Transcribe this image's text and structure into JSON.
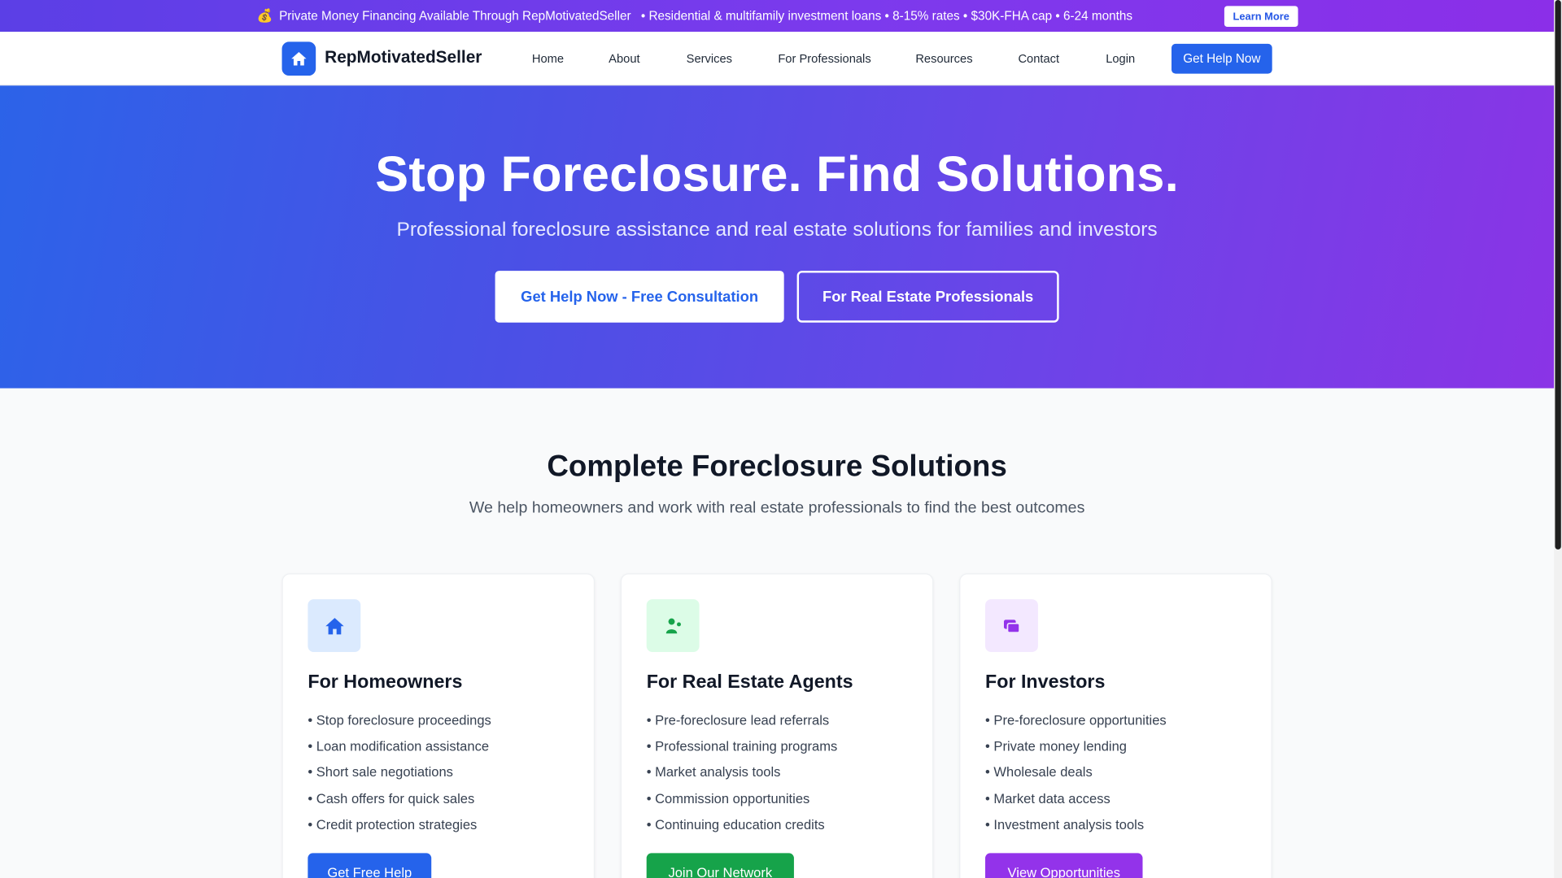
{
  "topbar": {
    "icon": "money-bag-icon",
    "emoji": "💰",
    "text_main": "Private Money Financing Available Through RepMotivatedSeller",
    "text_details": "• Residential & multifamily investment loans • 8-15% rates • $30K-FHA cap • 6-24 months",
    "learn_more": "Learn More"
  },
  "nav": {
    "brand": "RepMotivatedSeller",
    "links": [
      "Home",
      "About",
      "Services",
      "For Professionals",
      "Resources",
      "Contact",
      "Login"
    ],
    "cta": "Get Help Now"
  },
  "hero": {
    "title": "Stop Foreclosure. Find Solutions.",
    "subtitle": "Professional foreclosure assistance and real estate solutions for families and investors",
    "primary_button": "Get Help Now - Free Consultation",
    "secondary_button": "For Real Estate Professionals"
  },
  "solutions": {
    "title": "Complete Foreclosure Solutions",
    "subtitle": "We help homeowners and work with real estate professionals to find the best outcomes",
    "cards": [
      {
        "icon": "home-icon",
        "title": "For Homeowners",
        "items": [
          "Stop foreclosure proceedings",
          "Loan modification assistance",
          "Short sale negotiations",
          "Cash offers for quick sales",
          "Credit protection strategies"
        ],
        "button": "Get Free Help"
      },
      {
        "icon": "user-network-icon",
        "title": "For Real Estate Agents",
        "items": [
          "Pre-foreclosure lead referrals",
          "Professional training programs",
          "Market analysis tools",
          "Commission opportunities",
          "Continuing education credits"
        ],
        "button": "Join Our Network"
      },
      {
        "icon": "portfolio-icon",
        "title": "For Investors",
        "items": [
          "Pre-foreclosure opportunities",
          "Private money lending",
          "Wholesale deals",
          "Market data access",
          "Investment analysis tools"
        ],
        "button": "View Opportunities"
      }
    ]
  },
  "colors": {
    "primary_blue": "#2563eb",
    "green": "#16a34a",
    "purple": "#9333ea",
    "hero_gradient_start": "#2c63e8",
    "hero_gradient_end": "#8a34e6"
  }
}
